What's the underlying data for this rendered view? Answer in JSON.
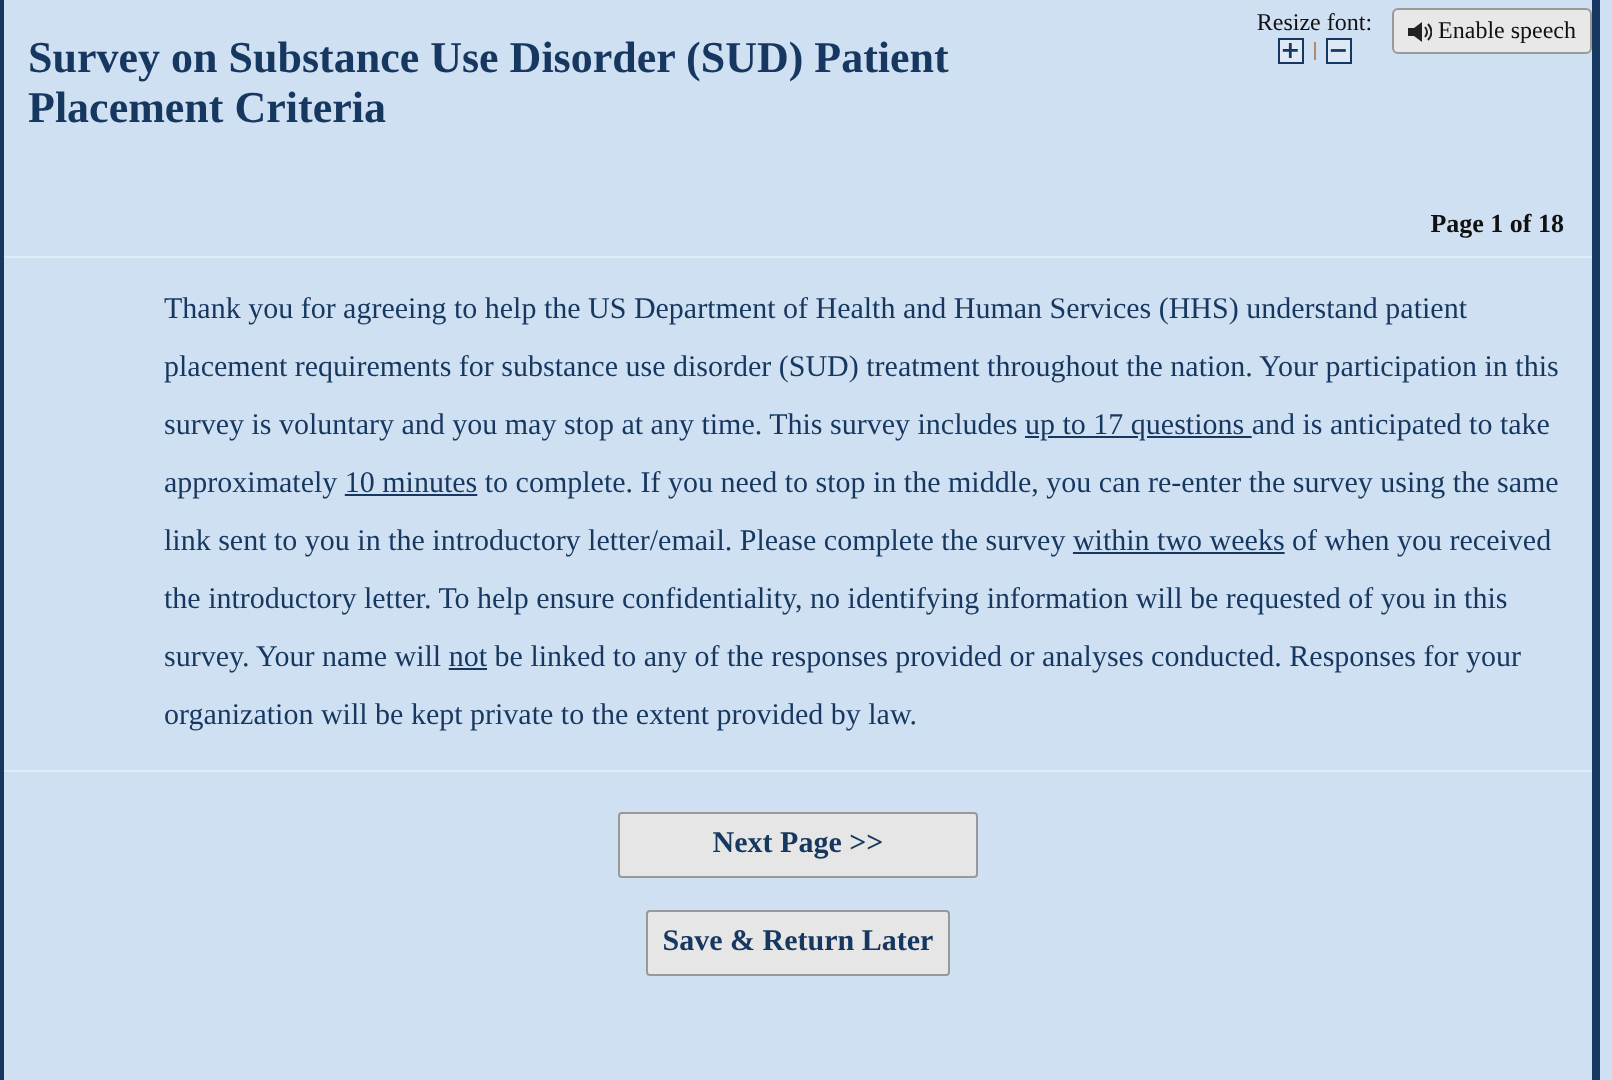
{
  "title": "Survey on Substance Use Disorder (SUD) Patient Placement Criteria",
  "resize_font": {
    "label": "Resize font:",
    "increase": "+",
    "decrease": "−"
  },
  "speech_button": {
    "label": "Enable speech"
  },
  "page_indicator": "Page 1 of 18",
  "intro": [
    {
      "text": "Thank you for agreeing to help the US Department of Health and Human Services (HHS) understand patient placement requirements for substance use disorder (SUD) treatment throughout the nation. Your participation in this survey is voluntary and you may stop at any time. This survey includes ",
      "underlined": false
    },
    {
      "text": "up to 17 questions ",
      "underlined": true
    },
    {
      "text": " and is anticipated to take approximately ",
      "underlined": false
    },
    {
      "text": "10 minutes",
      "underlined": true
    },
    {
      "text": " to complete. If you need to stop in the middle, you can re-enter the survey using the same link sent to you in the introductory letter/email. Please complete the survey ",
      "underlined": false
    },
    {
      "text": "within two weeks",
      "underlined": true
    },
    {
      "text": " of when you received the introductory letter. To help ensure confidentiality, no identifying information will be requested of you in this survey. Your name will ",
      "underlined": false
    },
    {
      "text": "not",
      "underlined": true
    },
    {
      "text": " be linked to any of the responses provided or analyses conducted. Responses for your organization will be kept private to the extent provided by law.",
      "underlined": false
    }
  ],
  "buttons": [
    {
      "label": "Next Page >>",
      "kind": "next"
    },
    {
      "label": "Save & Return Later",
      "kind": "save"
    }
  ]
}
